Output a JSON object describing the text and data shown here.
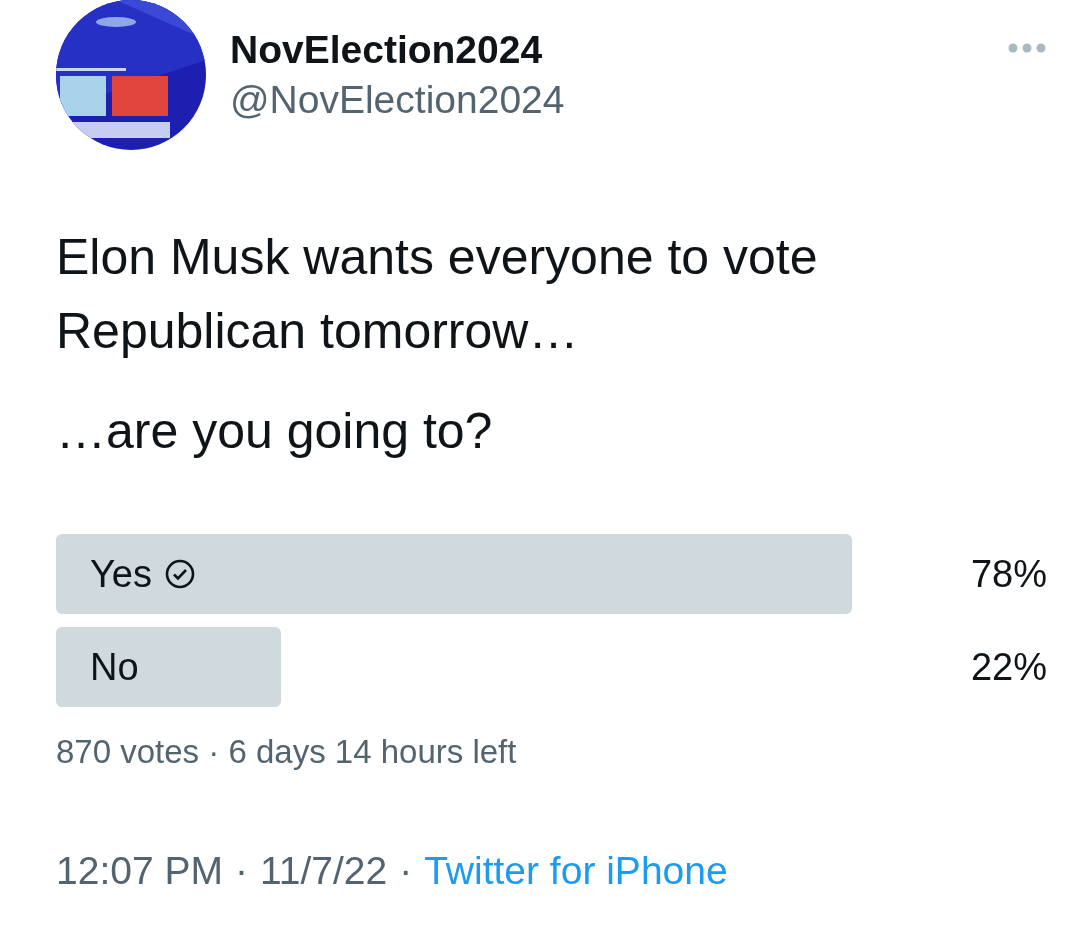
{
  "author": {
    "name": "NovElection2024",
    "handle": "@NovElection2024"
  },
  "text": [
    "Elon Musk wants everyone to vote Republican tomorrow…",
    "…are you going to?"
  ],
  "poll": {
    "options": [
      {
        "label": "Yes",
        "selected": true,
        "level": 0.78,
        "percent": "78%"
      },
      {
        "label": "No",
        "selected": false,
        "level": 0.22,
        "percent": "22%"
      }
    ],
    "summary": "870 votes · 6 days 14 hours left"
  },
  "footer": {
    "time": "12:07 PM",
    "separator_1": "·",
    "date": "11/7/22",
    "separator_2": "·",
    "source": "Twitter for iPhone"
  }
}
